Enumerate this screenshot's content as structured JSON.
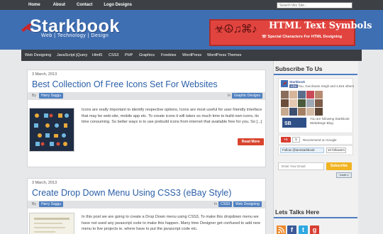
{
  "topnav": {
    "home": "Home",
    "about": "About",
    "contact": "Contact",
    "logos": "Logo Designs"
  },
  "search": {
    "placeholder": "Search this Site..."
  },
  "site": {
    "title": "Starkbook",
    "tagline": "Web | Technology | Design"
  },
  "banner": {
    "title": "HTML Text Symbols",
    "subtitle": "☏ Special Characters For HTML Designing",
    "symbols": "☣☮♫⌘♪"
  },
  "navbar": [
    "Web Designing",
    "JavaScript jQuery",
    "Html5",
    "CSS3",
    "PHP",
    "Graphics",
    "Freebies",
    "WordPress",
    "WordPress Themes"
  ],
  "posts": [
    {
      "date": "3 March, 2013",
      "title": "Best Collection Of Free Icons Set For Websites",
      "by": "By",
      "author": "Harry Saggu",
      "in": "In",
      "categories": [
        "Graphic Designs"
      ],
      "excerpt": "Icons are really important to identify respective options, Icons are most useful for user friendly interface that may be web-site, mobile app etc. To create icons it will takes so much time to build own icons, its time consuming. So better ways is to use prebuild icons from internet that available free for you. So [...]",
      "read_more": "Read More"
    },
    {
      "date": "3 March, 2013",
      "title": "Create Drop Down Menu Using CSS3 (eBay Style)",
      "by": "By",
      "author": "Harry Saggu",
      "in": "In",
      "categories": [
        "CSS3",
        "Web Designing"
      ],
      "excerpt": "In this post we are going to create a Drop Down menu using CSS3, To make this dropdown menu we have not used any javascript code to make this happen. Many time Designer get confused to add new menu to live projects ie. where have to put the javascript code etc."
    }
  ],
  "sidebar": {
    "subscribe_heading": "Subscribe To Us",
    "fb_page": "Starkbook",
    "fb_like": "Like",
    "fb_friend": "You, Gurcharan Singh and 4,816 others",
    "fb_follow": "You are following Starkbook Webdesign Blog.",
    "gplus_label": "+1",
    "gplus_count": "5",
    "gplus_text": "Recommend on Google",
    "twitter_follow": "Follow @iamstarkbook",
    "twitter_count": "10 followers",
    "email_placeholder": "Enter Your Email",
    "subscribe_btn": "Subscribe",
    "reader_badge": "reader s",
    "talks_heading": "Lets Talks Here"
  },
  "colors": {
    "header": "#3f6fb3",
    "topbar": "#3d4045",
    "link": "#2a5fa8",
    "accent": "#d8452e",
    "banner": "#e1443f"
  }
}
